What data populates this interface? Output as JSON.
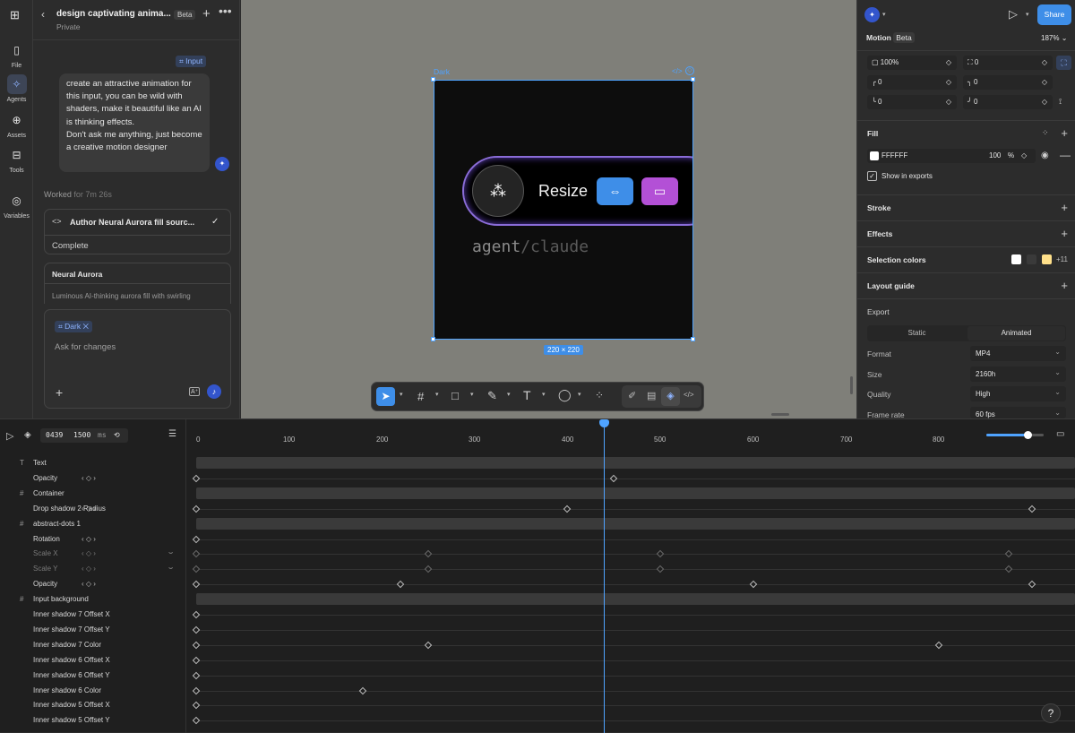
{
  "rail": {
    "items": [
      {
        "label": "File",
        "icon": "file-icon",
        "glyph": "🗋"
      },
      {
        "label": "Agents",
        "icon": "agents-icon",
        "glyph": "⌖"
      },
      {
        "label": "Assets",
        "icon": "assets-icon",
        "glyph": "⊕"
      },
      {
        "label": "Tools",
        "icon": "tools-icon",
        "glyph": "⌨"
      },
      {
        "label": "Variables",
        "icon": "variables-icon",
        "glyph": "◎"
      }
    ]
  },
  "chat": {
    "title": "design captivating anima...",
    "badge": "Beta",
    "subtitle": "Private",
    "input_chip": "Input",
    "prompt": "create an attractive animation for this input, you can be wild with shaders, make it beautiful like an AI is thinking effects.\nDon't ask me anything, just become a creative motion designer",
    "worked_label": "Worked",
    "worked_time": "for 7m 26s",
    "task_title": "Author Neural Aurora fill sourc...",
    "task_status": "Complete",
    "card_title": "Neural Aurora",
    "card_desc": "Luminous AI-thinking aurora fill with swirling",
    "compose_chip": "Dark",
    "compose_placeholder": "Ask for changes"
  },
  "canvas": {
    "frame_label": "Dark",
    "frame_size": "220 × 220",
    "resize_label": "Resize",
    "agent_text": "agent",
    "agent_sep": "/",
    "agent_sub": "claude"
  },
  "props": {
    "share": "Share",
    "motion_label": "Motion",
    "motion_badge": "Beta",
    "zoom": "187%",
    "opacity": "100%",
    "f1": "0",
    "f2": "0",
    "f3": "0",
    "f4": "0",
    "f5": "0",
    "fill_label": "Fill",
    "fill_hex": "FFFFFF",
    "fill_opacity": "100",
    "fill_pct": "%",
    "show_exports": "Show in exports",
    "stroke": "Stroke",
    "effects": "Effects",
    "selection_colors": "Selection colors",
    "sel_more": "+11",
    "layout_guide": "Layout guide",
    "export": "Export",
    "seg_static": "Static",
    "seg_animated": "Animated",
    "format_label": "Format",
    "format_val": "MP4",
    "size_label": "Size",
    "size_val": "2160h",
    "quality_label": "Quality",
    "quality_val": "High",
    "framerate_label": "Frame rate",
    "framerate_val": "60 fps"
  },
  "timeline": {
    "current": "0439",
    "duration": "1500",
    "unit": "ms",
    "ticks": [
      "0",
      "100",
      "200",
      "300",
      "400",
      "500",
      "600",
      "700",
      "800"
    ],
    "tracks": [
      {
        "label": "Text",
        "group": true,
        "dim": false
      },
      {
        "label": "Opacity",
        "group": false,
        "dim": false
      },
      {
        "label": "Container",
        "group": true,
        "dim": false
      },
      {
        "label": "Drop shadow 2 Radius",
        "group": false,
        "dim": false
      },
      {
        "label": "abstract-dots 1",
        "group": true,
        "dim": false
      },
      {
        "label": "Rotation",
        "group": false,
        "dim": false
      },
      {
        "label": "Scale X",
        "group": false,
        "dim": true
      },
      {
        "label": "Scale Y",
        "group": false,
        "dim": true
      },
      {
        "label": "Opacity",
        "group": false,
        "dim": false
      },
      {
        "label": "Input background",
        "group": true,
        "dim": false
      },
      {
        "label": "Inner shadow 7 Offset X",
        "group": false,
        "dim": false
      },
      {
        "label": "Inner shadow 7 Offset Y",
        "group": false,
        "dim": false
      },
      {
        "label": "Inner shadow 7 Color",
        "group": false,
        "dim": false
      },
      {
        "label": "Inner shadow 6 Offset X",
        "group": false,
        "dim": false
      },
      {
        "label": "Inner shadow 6 Offset Y",
        "group": false,
        "dim": false
      },
      {
        "label": "Inner shadow 6 Color",
        "group": false,
        "dim": false
      },
      {
        "label": "Inner shadow 5 Offset X",
        "group": false,
        "dim": false
      },
      {
        "label": "Inner shadow 5 Offset Y",
        "group": false,
        "dim": false
      }
    ],
    "help": "?"
  }
}
